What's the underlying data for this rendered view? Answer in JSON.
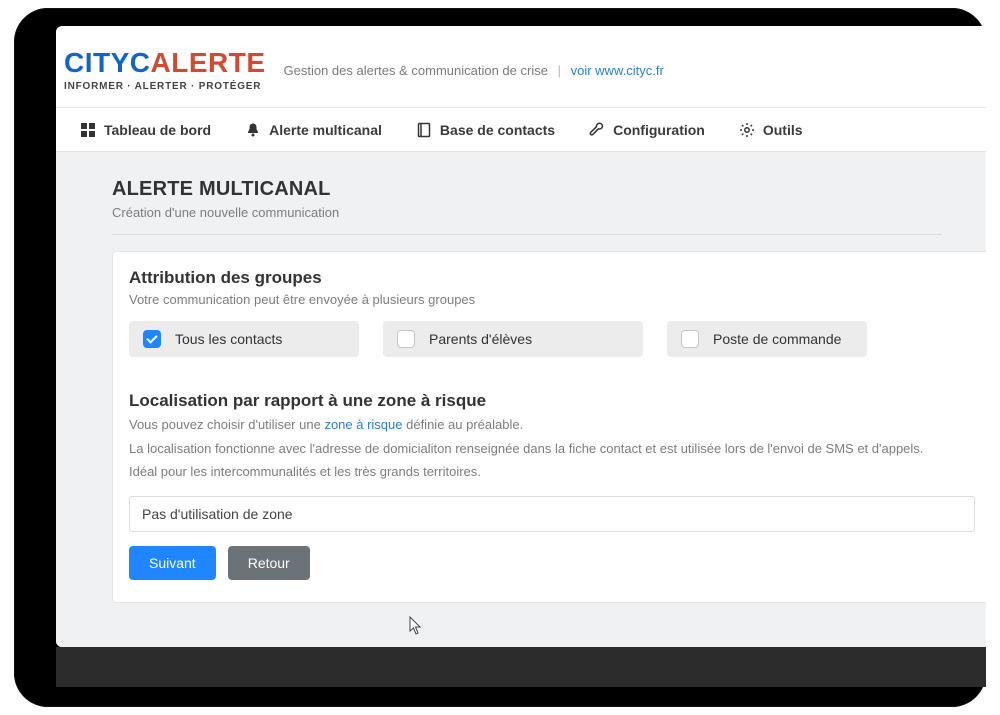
{
  "header": {
    "logo_part1": "CITYC",
    "logo_part2": "ALERTE",
    "logo_strapline": "INFORMER · ALERTER · PROTÉGER",
    "tagline_text": "Gestion des alertes & communication de crise",
    "tagline_link_prefix": "voir ",
    "tagline_link": "www.cityc.fr"
  },
  "nav": {
    "items": [
      {
        "label": "Tableau de bord"
      },
      {
        "label": "Alerte multicanal"
      },
      {
        "label": "Base de contacts"
      },
      {
        "label": "Configuration"
      },
      {
        "label": "Outils"
      }
    ]
  },
  "page": {
    "title": "ALERTE MULTICANAL",
    "subtitle": "Création d'une nouvelle communication"
  },
  "groups_section": {
    "title": "Attribution des groupes",
    "subtitle": "Votre communication peut être envoyée à plusieurs groupes",
    "options": [
      {
        "label": "Tous les contacts",
        "checked": true
      },
      {
        "label": "Parents d'élèves",
        "checked": false
      },
      {
        "label": "Poste de commande",
        "checked": false
      }
    ]
  },
  "zone_section": {
    "title": "Localisation par rapport à une zone à risque",
    "desc_line1_pre": "Vous pouvez choisir d'utiliser une ",
    "desc_line1_link": "zone à risque",
    "desc_line1_post": " définie au préalable.",
    "desc_line2": "La localisation fonctionne avec l'adresse de domicialiton renseignée dans la fiche contact et est utilisée lors de l'envoi de SMS et d'appels.",
    "desc_line3": "Idéal pour les intercommunalités et les très grands territoires.",
    "select_value": "Pas d'utilisation de zone"
  },
  "actions": {
    "next": "Suivant",
    "back": "Retour"
  }
}
